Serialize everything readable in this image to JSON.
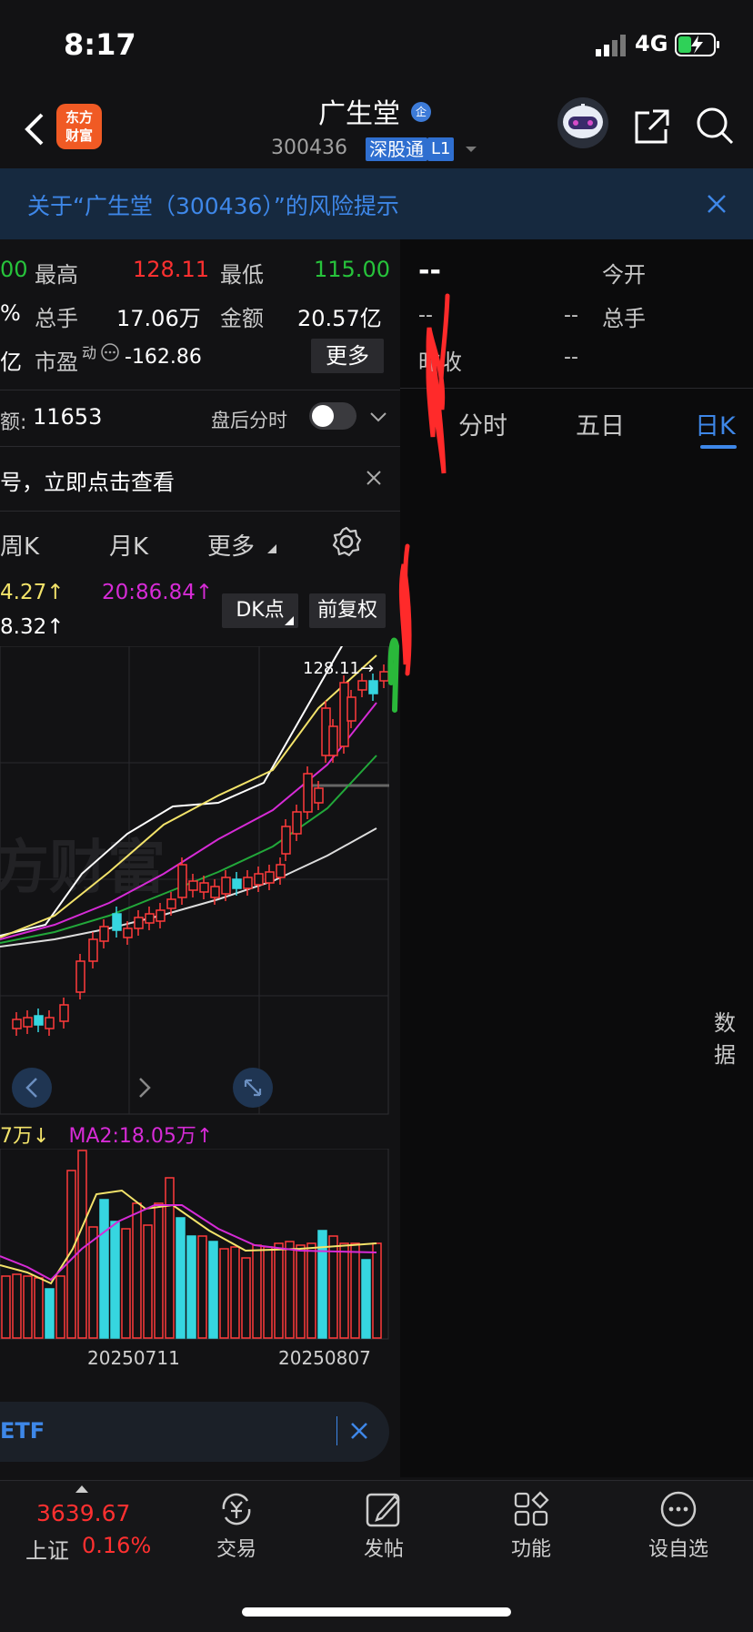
{
  "status": {
    "time": "8:17",
    "network": "4G"
  },
  "header": {
    "logo": "东方\n财富",
    "name": "广生堂",
    "name_badge": "企",
    "code": "300436",
    "badge_sgt": "深股通",
    "badge_l1": "L1",
    "icons": [
      "back-icon",
      "robot-avatar-icon",
      "share-icon",
      "search-icon"
    ]
  },
  "risk_banner": {
    "text": "关于“广生堂（300436）”的风险提示"
  },
  "quote": {
    "r1": {
      "c0": "00",
      "high_label": "最高",
      "high": "128.11",
      "low_label": "最低",
      "low": "115.00"
    },
    "r2": {
      "c0": "%",
      "vol_label": "总手",
      "vol": "17.06万",
      "amount_label": "金额",
      "amount": "20.57亿"
    },
    "r3": {
      "c0": "亿",
      "pe_label": "市盈",
      "pe_sup": "动",
      "pe": "-162.86",
      "more": "更多"
    }
  },
  "after_hours": {
    "label": "额:",
    "value": "11653",
    "switch_label": "盘后分时"
  },
  "promo": {
    "text": "号，立即点击查看"
  },
  "chart_tabs": {
    "week": "周K",
    "month": "月K",
    "more": "更多"
  },
  "ma_legend": {
    "l1": "4.27↑",
    "l2": "20:86.84↑",
    "l3": "8.32↑"
  },
  "chart_buttons": {
    "dk": "DK点",
    "fq": "前复权"
  },
  "high_marker": "128.11→",
  "watermark": "方财富",
  "vol_legend": {
    "a": "7万↓",
    "b": "MA2:18.05万↑"
  },
  "dates": {
    "d1": "20250711",
    "d2": "20250807"
  },
  "etf": {
    "text": "ETF"
  },
  "right": {
    "dashes": "--",
    "open_label": "今开",
    "vol_label": "总手",
    "prev_label": "昨收",
    "val_a": "--",
    "val_b": "--",
    "val_c": "--",
    "tabs": [
      "分时",
      "五日",
      "日K"
    ],
    "data_text": "数据"
  },
  "bottom_nav": {
    "index_value": "3639.67",
    "index_name": "上证",
    "index_pct": "0.16%",
    "items": [
      "交易",
      "发帖",
      "功能",
      "设自选"
    ]
  },
  "colors": {
    "up": "#ff3030",
    "down": "#27c33b",
    "cyan": "#36d6e0",
    "accent": "#3e87e8"
  },
  "chart_data": {
    "type": "bar",
    "title": "",
    "xlabel": "",
    "ylabel": "",
    "x": [
      "20250711",
      "20250807"
    ],
    "high_marker_value": 128.11
  }
}
